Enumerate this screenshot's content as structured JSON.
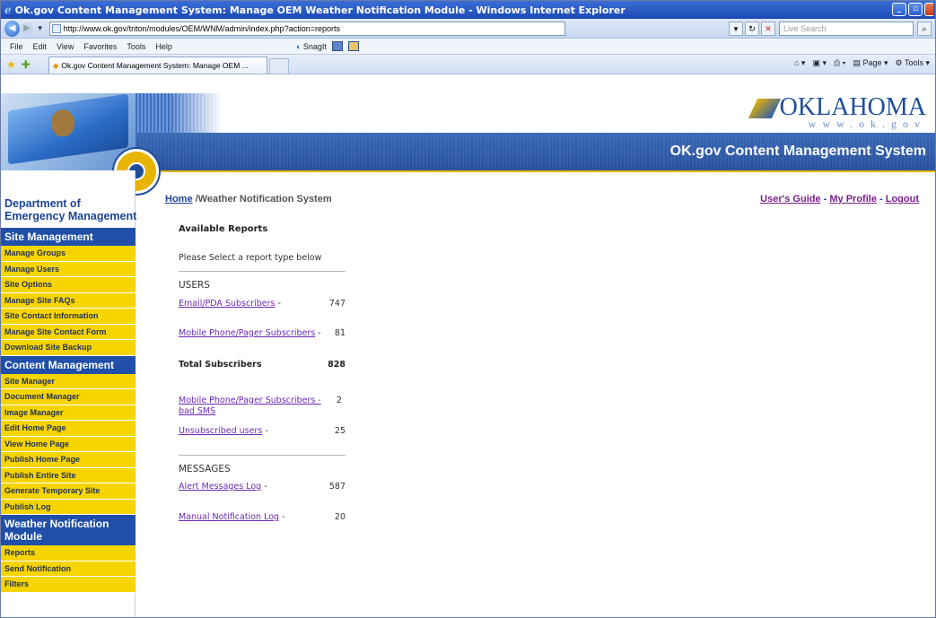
{
  "window": {
    "title": "Ok.gov Content Management System: Manage OEM Weather Notification Module - Windows Internet Explorer"
  },
  "browser": {
    "url": "http://www.ok.gov/triton/modules/OEM/WNM/admin/index.php?action=reports",
    "search_placeholder": "Live Search",
    "menu": [
      "File",
      "Edit",
      "View",
      "Favorites",
      "Tools",
      "Help"
    ],
    "snagit": "SnagIt",
    "tab_title": "Ok.gov Content Management System: Manage OEM ...",
    "cmd": {
      "page": "Page",
      "tools": "Tools"
    }
  },
  "banner": {
    "logo_name": "OKLAHOMA",
    "logo_url": "www.ok.gov",
    "site_title": "OK.gov Content Management System"
  },
  "sidebar": {
    "dept_line1": "Department of",
    "dept_line2": "Emergency Management",
    "site_mgmt": {
      "heading": "Site Management",
      "items": [
        "Manage Groups",
        "Manage Users",
        "Site Options",
        "Manage Site FAQs",
        "Site Contact Information",
        "Manage Site Contact Form",
        "Download Site Backup"
      ]
    },
    "content_mgmt": {
      "heading": "Content Management",
      "items": [
        "Site Manager",
        "Document Manager",
        "Image Manager",
        "Edit Home Page",
        "View Home Page",
        "Publish Home Page",
        "Publish Entire Site",
        "Generate Temporary Site",
        "Publish Log"
      ]
    },
    "weather": {
      "heading": "Weather Notification Module",
      "items": [
        "Reports",
        "Send Notification",
        "Filters"
      ]
    }
  },
  "content": {
    "crumb_home": "Home",
    "crumb_current": "/Weather Notification System",
    "links": {
      "guide": "User's Guide",
      "profile": "My Profile",
      "logout": "Logout",
      "sep": " - "
    },
    "heading": "Available Reports",
    "subheading": "Please Select a report type below",
    "users_label": "USERS",
    "email": {
      "label": "Email/PDA Subscribers",
      "value": "747"
    },
    "mobile": {
      "label": "Mobile Phone/Pager Subscribers",
      "value": "81"
    },
    "total": {
      "label": "Total Subscribers",
      "value": "828"
    },
    "bad_sms": {
      "label": "Mobile Phone/Pager Subscribers - bad SMS",
      "value": "2"
    },
    "unsub": {
      "label": "Unsubscribed users",
      "value": "25"
    },
    "messages_label": "MESSAGES",
    "alerts": {
      "label": "Alert Messages Log",
      "value": "587"
    },
    "manual": {
      "label": "Manual Notification Log",
      "value": "20"
    },
    "dash": " -"
  }
}
